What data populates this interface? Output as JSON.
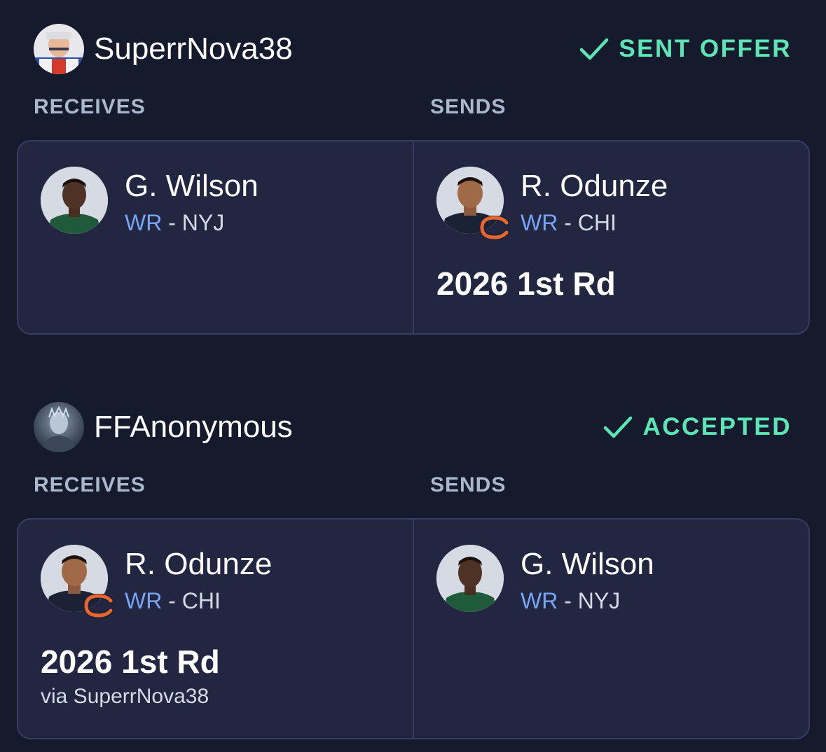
{
  "trades": [
    {
      "user": "SuperrNova38",
      "status": "SENT OFFER",
      "receives_label": "RECEIVES",
      "sends_label": "SENDS",
      "receives": {
        "player_name": "G. Wilson",
        "position": "WR",
        "separator": " - ",
        "team": "NYJ"
      },
      "sends": {
        "player_name": "R. Odunze",
        "position": "WR",
        "separator": " - ",
        "team": "CHI",
        "pick": "2026 1st Rd"
      }
    },
    {
      "user": "FFAnonymous",
      "status": "ACCEPTED",
      "receives_label": "RECEIVES",
      "sends_label": "SENDS",
      "receives": {
        "player_name": "R. Odunze",
        "position": "WR",
        "separator": " - ",
        "team": "CHI",
        "pick": "2026 1st Rd",
        "pick_via": "via SuperrNova38"
      },
      "sends": {
        "player_name": "G. Wilson",
        "position": "WR",
        "separator": " - ",
        "team": "NYJ"
      }
    }
  ],
  "colors": {
    "background": "#161a2d",
    "card": "#232641",
    "status": "#5ce6b5",
    "position": "#78a6f4",
    "label": "#a9b8cd"
  },
  "icons": {
    "status": "checkmark-icon",
    "chi_logo": "bears-c-logo-icon",
    "nyj_logo": "jets-jersey"
  }
}
